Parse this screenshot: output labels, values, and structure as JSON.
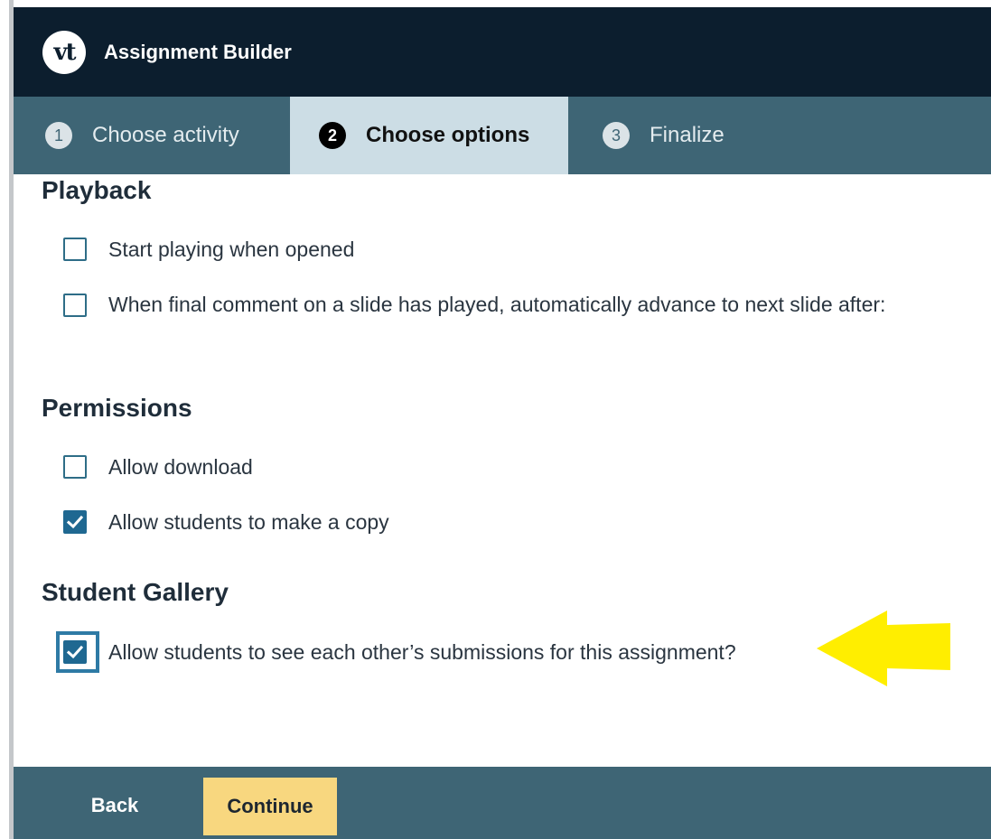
{
  "header": {
    "logo_text": "vt",
    "title": "Assignment Builder"
  },
  "steps": [
    {
      "number": "1",
      "label": "Choose activity",
      "active": false
    },
    {
      "number": "2",
      "label": "Choose options",
      "active": true
    },
    {
      "number": "3",
      "label": "Finalize",
      "active": false
    }
  ],
  "sections": {
    "playback": {
      "heading": "Playback",
      "options": [
        {
          "label": "Start playing when opened",
          "checked": false
        },
        {
          "label": "When final comment on a slide has played, automatically advance to next slide after:",
          "checked": false
        }
      ]
    },
    "permissions": {
      "heading": "Permissions",
      "options": [
        {
          "label": "Allow download",
          "checked": false
        },
        {
          "label": "Allow students to make a copy",
          "checked": true
        }
      ]
    },
    "student_gallery": {
      "heading": "Student Gallery",
      "options": [
        {
          "label": "Allow students to see each other’s submissions for this assignment?",
          "checked": true
        }
      ]
    }
  },
  "annotation": {
    "icon": "yellow-arrow-left-icon",
    "color": "#ffee00"
  },
  "footer": {
    "back_label": "Back",
    "continue_label": "Continue"
  },
  "colors": {
    "header_bg": "#0c1e2e",
    "tab_bar_bg": "#3e6575",
    "active_tab_bg": "#ccdde5",
    "checkbox_checked": "#1f6891",
    "continue_button": "#f8d77f"
  }
}
